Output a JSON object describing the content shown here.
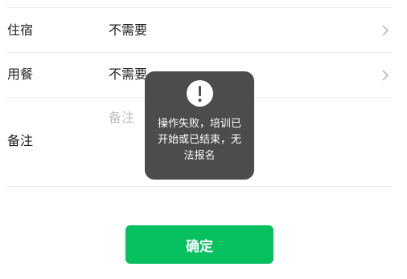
{
  "form": {
    "rows": [
      {
        "label": "住宿",
        "value": "不需要"
      },
      {
        "label": "用餐",
        "value": "不需要"
      }
    ],
    "remark": {
      "label": "备注",
      "placeholder": "备注"
    }
  },
  "confirm_button": {
    "label": "确定"
  },
  "toast": {
    "icon": "exclamation-circle-icon",
    "message": "操作失败，培训已\n开始或已结束，无\n法报名"
  },
  "colors": {
    "primary": "#07c160",
    "toast_bg": "#4c4c4c",
    "placeholder": "#bdbdbd",
    "divider": "#ededed"
  }
}
